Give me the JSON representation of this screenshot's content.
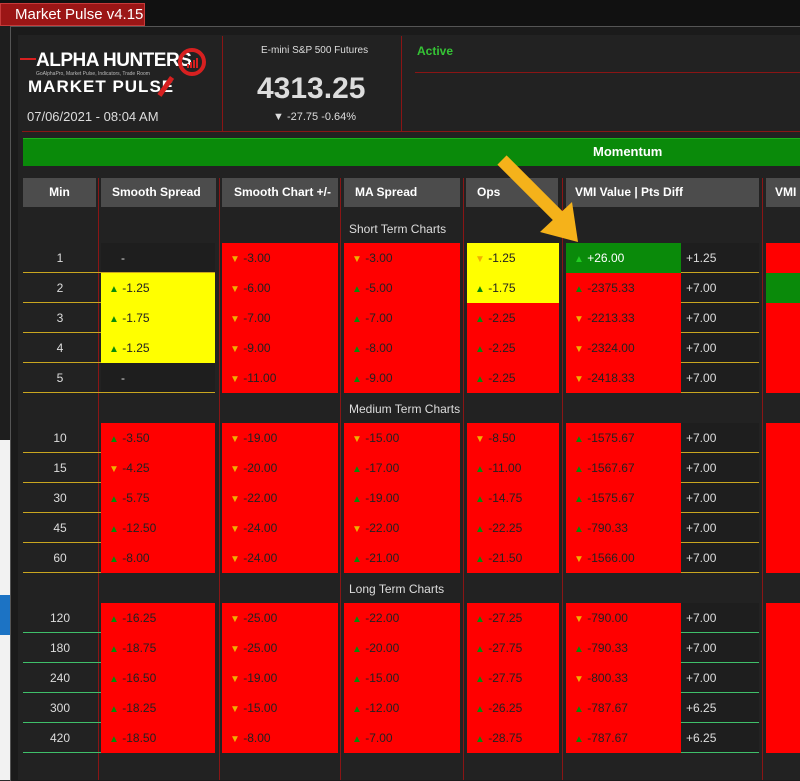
{
  "window": {
    "title": "Market Pulse v4.15"
  },
  "brand": {
    "line1": "ALPHA HUNTERS",
    "tagline": "GoAlphaPro, Market Pulse, Indicators, Trade Room",
    "line2": "MARKET PULSE"
  },
  "datetime": "07/06/2021 - 08:04 AM",
  "instrument": {
    "name": "E-mini S&P 500 Futures",
    "price": "4313.25",
    "change": "▼ -27.75 -0.64%"
  },
  "status": "Active",
  "banner": "Momentum",
  "headers": {
    "min": "Min",
    "smooth_spread": "Smooth Spread",
    "smooth_chart": "Smooth Chart +/-",
    "ma_spread": "MA Spread",
    "ops": "Ops",
    "vmi": "VMI Value | Pts Diff",
    "vmi2": "VMI C"
  },
  "sections": [
    {
      "label": "Short Term Charts"
    },
    {
      "label": "Medium Term Charts"
    },
    {
      "label": "Long Term Charts"
    }
  ],
  "rows": [
    {
      "min": "1",
      "ss": {
        "dir": "",
        "v": "-",
        "c": "dark"
      },
      "sc": {
        "dir": "dn",
        "v": "-3.00",
        "c": "red"
      },
      "ma": {
        "dir": "dn",
        "v": "-3.00",
        "c": "red"
      },
      "ops": {
        "dir": "dn",
        "v": "-1.25",
        "c": "yel"
      },
      "vmi": {
        "dir": "up",
        "v": "+26.00",
        "c": "grn"
      },
      "diff": "+1.25",
      "strip": "red"
    },
    {
      "min": "2",
      "ss": {
        "dir": "up",
        "v": "-1.25",
        "c": "yel"
      },
      "sc": {
        "dir": "dn",
        "v": "-6.00",
        "c": "red"
      },
      "ma": {
        "dir": "up",
        "v": "-5.00",
        "c": "red"
      },
      "ops": {
        "dir": "up",
        "v": "-1.75",
        "c": "yel"
      },
      "vmi": {
        "dir": "up",
        "v": "-2375.33",
        "c": "red"
      },
      "diff": "+7.00",
      "strip": "grn"
    },
    {
      "min": "3",
      "ss": {
        "dir": "up",
        "v": "-1.75",
        "c": "yel"
      },
      "sc": {
        "dir": "dn",
        "v": "-7.00",
        "c": "red"
      },
      "ma": {
        "dir": "up",
        "v": "-7.00",
        "c": "red"
      },
      "ops": {
        "dir": "up",
        "v": "-2.25",
        "c": "red"
      },
      "vmi": {
        "dir": "dn",
        "v": "-2213.33",
        "c": "red"
      },
      "diff": "+7.00",
      "strip": "red"
    },
    {
      "min": "4",
      "ss": {
        "dir": "up",
        "v": "-1.25",
        "c": "yel"
      },
      "sc": {
        "dir": "dn",
        "v": "-9.00",
        "c": "red"
      },
      "ma": {
        "dir": "up",
        "v": "-8.00",
        "c": "red"
      },
      "ops": {
        "dir": "up",
        "v": "-2.25",
        "c": "red"
      },
      "vmi": {
        "dir": "dn",
        "v": "-2324.00",
        "c": "red"
      },
      "diff": "+7.00",
      "strip": "red"
    },
    {
      "min": "5",
      "ss": {
        "dir": "",
        "v": "-",
        "c": "dark"
      },
      "sc": {
        "dir": "dn",
        "v": "-11.00",
        "c": "red"
      },
      "ma": {
        "dir": "up",
        "v": "-9.00",
        "c": "red"
      },
      "ops": {
        "dir": "up",
        "v": "-2.25",
        "c": "red"
      },
      "vmi": {
        "dir": "dn",
        "v": "-2418.33",
        "c": "red"
      },
      "diff": "+7.00",
      "strip": "red"
    },
    {
      "min": "10",
      "ss": {
        "dir": "up",
        "v": "-3.50",
        "c": "red"
      },
      "sc": {
        "dir": "dn",
        "v": "-19.00",
        "c": "red"
      },
      "ma": {
        "dir": "dn",
        "v": "-15.00",
        "c": "red"
      },
      "ops": {
        "dir": "dn",
        "v": "-8.50",
        "c": "red"
      },
      "vmi": {
        "dir": "up",
        "v": "-1575.67",
        "c": "red"
      },
      "diff": "+7.00",
      "strip": "red"
    },
    {
      "min": "15",
      "ss": {
        "dir": "dn",
        "v": "-4.25",
        "c": "red"
      },
      "sc": {
        "dir": "dn",
        "v": "-20.00",
        "c": "red"
      },
      "ma": {
        "dir": "up",
        "v": "-17.00",
        "c": "red"
      },
      "ops": {
        "dir": "up",
        "v": "-11.00",
        "c": "red"
      },
      "vmi": {
        "dir": "up",
        "v": "-1567.67",
        "c": "red"
      },
      "diff": "+7.00",
      "strip": "red"
    },
    {
      "min": "30",
      "ss": {
        "dir": "up",
        "v": "-5.75",
        "c": "red"
      },
      "sc": {
        "dir": "dn",
        "v": "-22.00",
        "c": "red"
      },
      "ma": {
        "dir": "up",
        "v": "-19.00",
        "c": "red"
      },
      "ops": {
        "dir": "up",
        "v": "-14.75",
        "c": "red"
      },
      "vmi": {
        "dir": "up",
        "v": "-1575.67",
        "c": "red"
      },
      "diff": "+7.00",
      "strip": "red"
    },
    {
      "min": "45",
      "ss": {
        "dir": "up",
        "v": "-12.50",
        "c": "red"
      },
      "sc": {
        "dir": "dn",
        "v": "-24.00",
        "c": "red"
      },
      "ma": {
        "dir": "dn",
        "v": "-22.00",
        "c": "red"
      },
      "ops": {
        "dir": "up",
        "v": "-22.25",
        "c": "red"
      },
      "vmi": {
        "dir": "up",
        "v": "-790.33",
        "c": "red"
      },
      "diff": "+7.00",
      "strip": "red"
    },
    {
      "min": "60",
      "ss": {
        "dir": "up",
        "v": "-8.00",
        "c": "red"
      },
      "sc": {
        "dir": "dn",
        "v": "-24.00",
        "c": "red"
      },
      "ma": {
        "dir": "up",
        "v": "-21.00",
        "c": "red"
      },
      "ops": {
        "dir": "up",
        "v": "-21.50",
        "c": "red"
      },
      "vmi": {
        "dir": "dn",
        "v": "-1566.00",
        "c": "red"
      },
      "diff": "+7.00",
      "strip": "red"
    },
    {
      "min": "120",
      "ss": {
        "dir": "up",
        "v": "-16.25",
        "c": "red"
      },
      "sc": {
        "dir": "dn",
        "v": "-25.00",
        "c": "red"
      },
      "ma": {
        "dir": "up",
        "v": "-22.00",
        "c": "red"
      },
      "ops": {
        "dir": "up",
        "v": "-27.25",
        "c": "red"
      },
      "vmi": {
        "dir": "dn",
        "v": "-790.00",
        "c": "red"
      },
      "diff": "+7.00",
      "strip": "red"
    },
    {
      "min": "180",
      "ss": {
        "dir": "up",
        "v": "-18.75",
        "c": "red"
      },
      "sc": {
        "dir": "dn",
        "v": "-25.00",
        "c": "red"
      },
      "ma": {
        "dir": "up",
        "v": "-20.00",
        "c": "red"
      },
      "ops": {
        "dir": "up",
        "v": "-27.75",
        "c": "red"
      },
      "vmi": {
        "dir": "up",
        "v": "-790.33",
        "c": "red"
      },
      "diff": "+7.00",
      "strip": "red"
    },
    {
      "min": "240",
      "ss": {
        "dir": "up",
        "v": "-16.50",
        "c": "red"
      },
      "sc": {
        "dir": "dn",
        "v": "-19.00",
        "c": "red"
      },
      "ma": {
        "dir": "up",
        "v": "-15.00",
        "c": "red"
      },
      "ops": {
        "dir": "up",
        "v": "-27.75",
        "c": "red"
      },
      "vmi": {
        "dir": "dn",
        "v": "-800.33",
        "c": "red"
      },
      "diff": "+7.00",
      "strip": "red"
    },
    {
      "min": "300",
      "ss": {
        "dir": "up",
        "v": "-18.25",
        "c": "red"
      },
      "sc": {
        "dir": "dn",
        "v": "-15.00",
        "c": "red"
      },
      "ma": {
        "dir": "up",
        "v": "-12.00",
        "c": "red"
      },
      "ops": {
        "dir": "up",
        "v": "-26.25",
        "c": "red"
      },
      "vmi": {
        "dir": "up",
        "v": "-787.67",
        "c": "red"
      },
      "diff": "+6.25",
      "strip": "red"
    },
    {
      "min": "420",
      "ss": {
        "dir": "up",
        "v": "-18.50",
        "c": "red"
      },
      "sc": {
        "dir": "dn",
        "v": "-8.00",
        "c": "red"
      },
      "ma": {
        "dir": "up",
        "v": "-7.00",
        "c": "red"
      },
      "ops": {
        "dir": "up",
        "v": "-28.75",
        "c": "red"
      },
      "vmi": {
        "dir": "up",
        "v": "-787.67",
        "c": "red"
      },
      "diff": "+6.25",
      "strip": "red"
    }
  ],
  "colors": {
    "red": "#ff0000",
    "yellow": "#ffff00",
    "green": "#0a8a0a",
    "arrow": "#f5b21a"
  },
  "icons": {
    "up": "▲",
    "down": "▼"
  }
}
